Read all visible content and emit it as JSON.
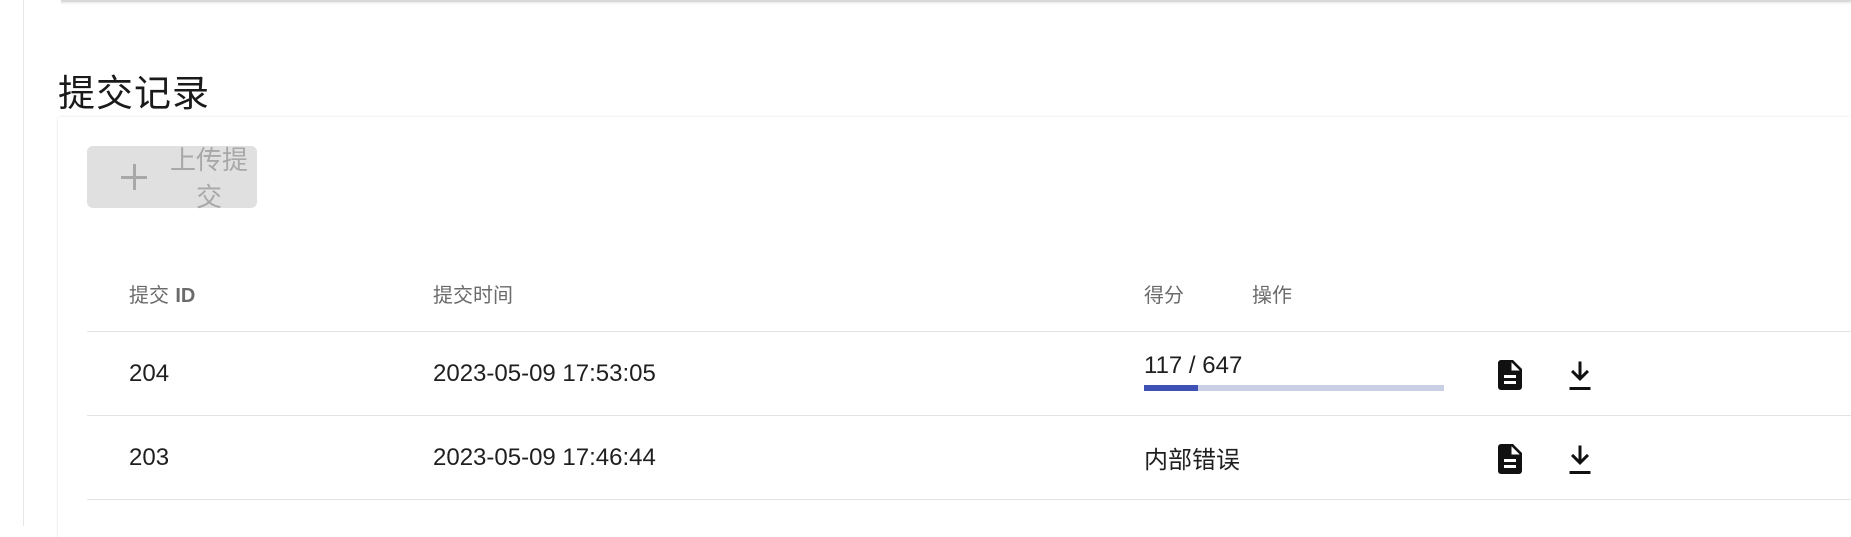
{
  "section": {
    "title": "提交记录"
  },
  "toolbar": {
    "upload_label": "上传提交"
  },
  "table": {
    "headers": {
      "id_prefix": "提交 ",
      "id_suffix": "ID",
      "time": "提交时间",
      "score": "得分",
      "actions": "操作"
    },
    "rows": [
      {
        "id": "204",
        "time": "2023-05-09 17:53:05",
        "score_text": "117 / 647",
        "score_fraction": 0.181,
        "status": "",
        "actions": [
          "file-icon",
          "download-icon"
        ]
      },
      {
        "id": "203",
        "time": "2023-05-09 17:46:44",
        "score_text": "",
        "status": "内部错误",
        "actions": [
          "file-icon",
          "download-icon"
        ]
      }
    ]
  },
  "colors": {
    "progress_fill": "#3f51b5",
    "progress_track": "#c9cfe4",
    "disabled_button": "#e0e0e0"
  }
}
